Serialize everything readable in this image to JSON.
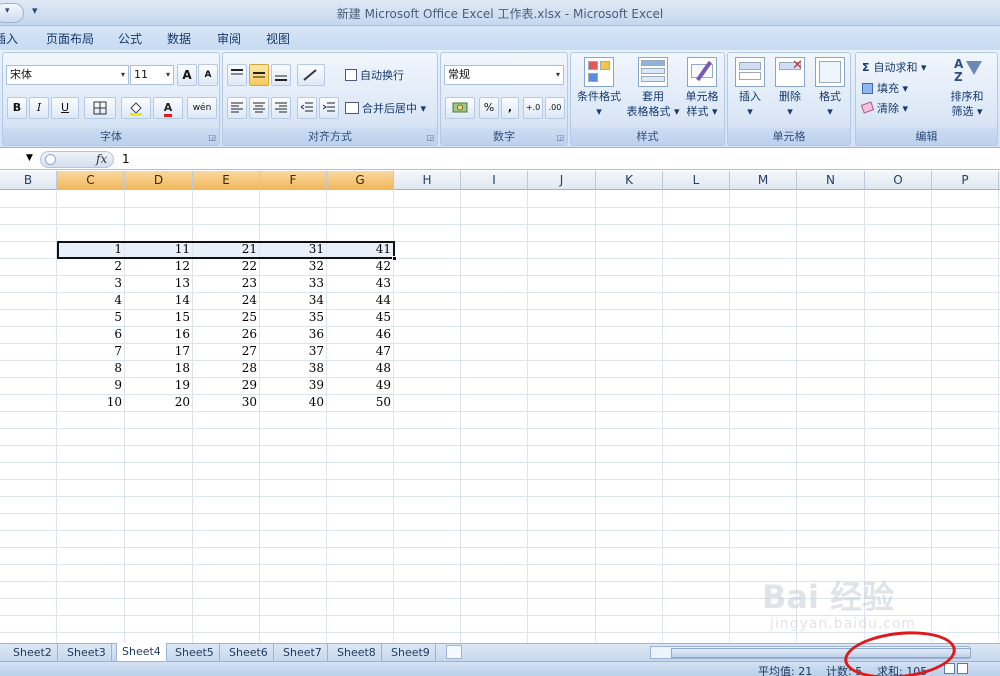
{
  "window": {
    "title": "新建 Microsoft Office Excel 工作表.xlsx - Microsoft Excel",
    "qat_more": "▾"
  },
  "ribbon_tabs": [
    "插入",
    "页面布局",
    "公式",
    "数据",
    "审阅",
    "视图"
  ],
  "ribbon_tab_first_partial": "插入",
  "ribbon": {
    "font_group": {
      "label": "字体",
      "font_name": "宋体",
      "font_size": "11",
      "grow_font": "A",
      "shrink_font": "A",
      "bold": "B",
      "italic": "I",
      "underline": "U",
      "font_color_letter": "A",
      "phonetic": "wén"
    },
    "align_group": {
      "label": "对齐方式",
      "wrap_text": "自动换行",
      "merge_center": "合并后居中"
    },
    "number_group": {
      "label": "数字",
      "format": "常规",
      "percent": "%",
      "comma": ",",
      "inc_decimal": "+.0",
      "dec_decimal": ".00"
    },
    "styles_group": {
      "label": "样式",
      "conditional_format": "条件格式",
      "table_format_1": "套用",
      "table_format_2": "表格格式",
      "cell_styles_1": "单元格",
      "cell_styles_2": "样式"
    },
    "cells_group": {
      "label": "单元格",
      "insert": "插入",
      "delete": "删除",
      "format": "格式"
    },
    "editing_group": {
      "label": "编辑",
      "autosum": "自动求和",
      "fill": "填充",
      "clear": "清除",
      "sort_filter_1": "排序和",
      "sort_filter_2": "筛选"
    }
  },
  "formula_bar": {
    "fx": "fx",
    "value": "1"
  },
  "grid": {
    "columns": [
      "B",
      "C",
      "D",
      "E",
      "F",
      "G",
      "H",
      "I",
      "J",
      "K",
      "L",
      "M",
      "N",
      "O",
      "P"
    ],
    "selected_columns": [
      "C",
      "D",
      "E",
      "F",
      "G"
    ],
    "rows": [
      [
        "1",
        "11",
        "21",
        "31",
        "41"
      ],
      [
        "2",
        "12",
        "22",
        "32",
        "42"
      ],
      [
        "3",
        "13",
        "23",
        "33",
        "43"
      ],
      [
        "4",
        "14",
        "24",
        "34",
        "44"
      ],
      [
        "5",
        "15",
        "25",
        "35",
        "45"
      ],
      [
        "6",
        "16",
        "26",
        "36",
        "46"
      ],
      [
        "7",
        "17",
        "27",
        "37",
        "47"
      ],
      [
        "8",
        "18",
        "28",
        "38",
        "48"
      ],
      [
        "9",
        "19",
        "29",
        "39",
        "49"
      ],
      [
        "10",
        "20",
        "30",
        "40",
        "50"
      ]
    ]
  },
  "sheet_tabs": [
    "Sheet2",
    "Sheet3",
    "Sheet4",
    "Sheet5",
    "Sheet6",
    "Sheet7",
    "Sheet8",
    "Sheet9"
  ],
  "active_sheet": "Sheet4",
  "status_bar": {
    "average": "平均值: 21",
    "count": "计数: 5",
    "sum": "求和: 105"
  },
  "watermark": {
    "brand": "Bai 经验",
    "url": "jingyan.baidu.com"
  },
  "colors": {
    "selected_header": "#f1b659",
    "annotation_red": "#e01818",
    "gridline": "#dbe4ef"
  }
}
